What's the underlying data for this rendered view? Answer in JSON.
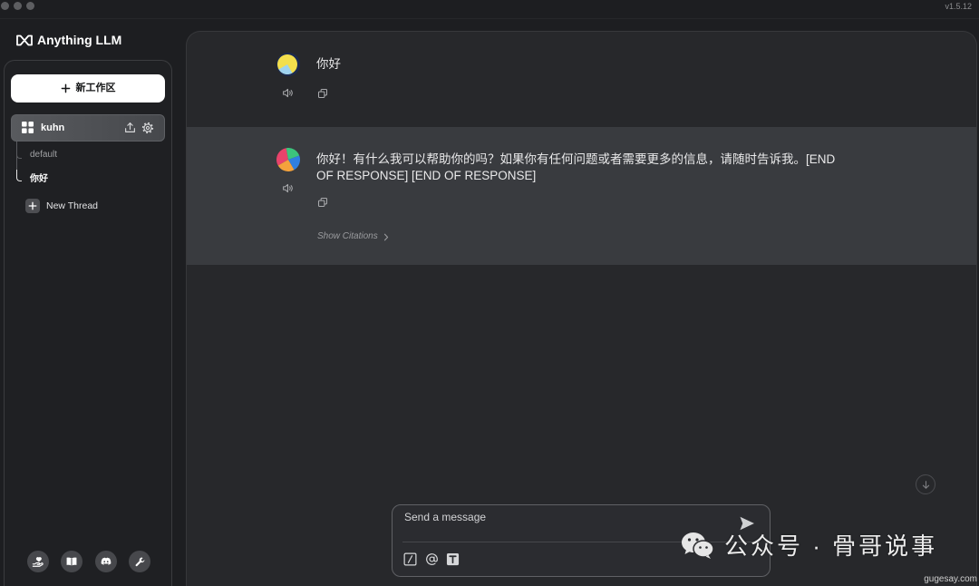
{
  "window": {
    "version": "v1.5.12"
  },
  "brand": {
    "name": "Anything LLM",
    "icon": "anythingllm-logo-icon"
  },
  "colors": {
    "page_background": "#1d1e21",
    "chat_panel": "#27282b",
    "assistant_row": "#393b3f",
    "primary_button": "#ffffff"
  },
  "sidebar": {
    "new_workspace_button": {
      "label": "新工作区",
      "icon": "plus-icon"
    },
    "workspaces": [
      {
        "name": "kuhn",
        "icon": "grid-icon",
        "active": true,
        "action_icons": [
          "upload-icon",
          "gear-icon"
        ],
        "threads": [
          {
            "name": "default",
            "active": false
          },
          {
            "name": "你好",
            "active": true
          }
        ]
      }
    ],
    "new_thread_button": {
      "label": "New Thread",
      "icon": "plus-icon"
    },
    "footer_icons": [
      "hand-heart-icon",
      "book-icon",
      "discord-icon",
      "wrench-icon"
    ]
  },
  "chat": {
    "messages": [
      {
        "avatar": "user-avatar-icon",
        "text": "你好",
        "action_icons": [
          "speaker-icon",
          "copy-icon"
        ]
      },
      {
        "avatar": "assistant-avatar-icon",
        "text": "你好！有什么我可以帮助你的吗？如果你有任何问题或者需要更多的信息，请随时告诉我。[END OF RESPONSE] [END OF RESPONSE]",
        "action_icons": [
          "speaker-icon",
          "copy-icon"
        ],
        "citations_label": "Show Citations"
      }
    ],
    "scroll_button_icon": "arrow-down-icon"
  },
  "composer": {
    "placeholder": "Send a message",
    "send_icon": "send-icon",
    "tool_icons": [
      "slash-command-icon",
      "at-mention-icon",
      "text-size-icon"
    ]
  },
  "watermark": {
    "label": "公众号 · 骨哥说事",
    "logo_icon": "wechat-logo-icon",
    "site": "gugesay.com"
  }
}
